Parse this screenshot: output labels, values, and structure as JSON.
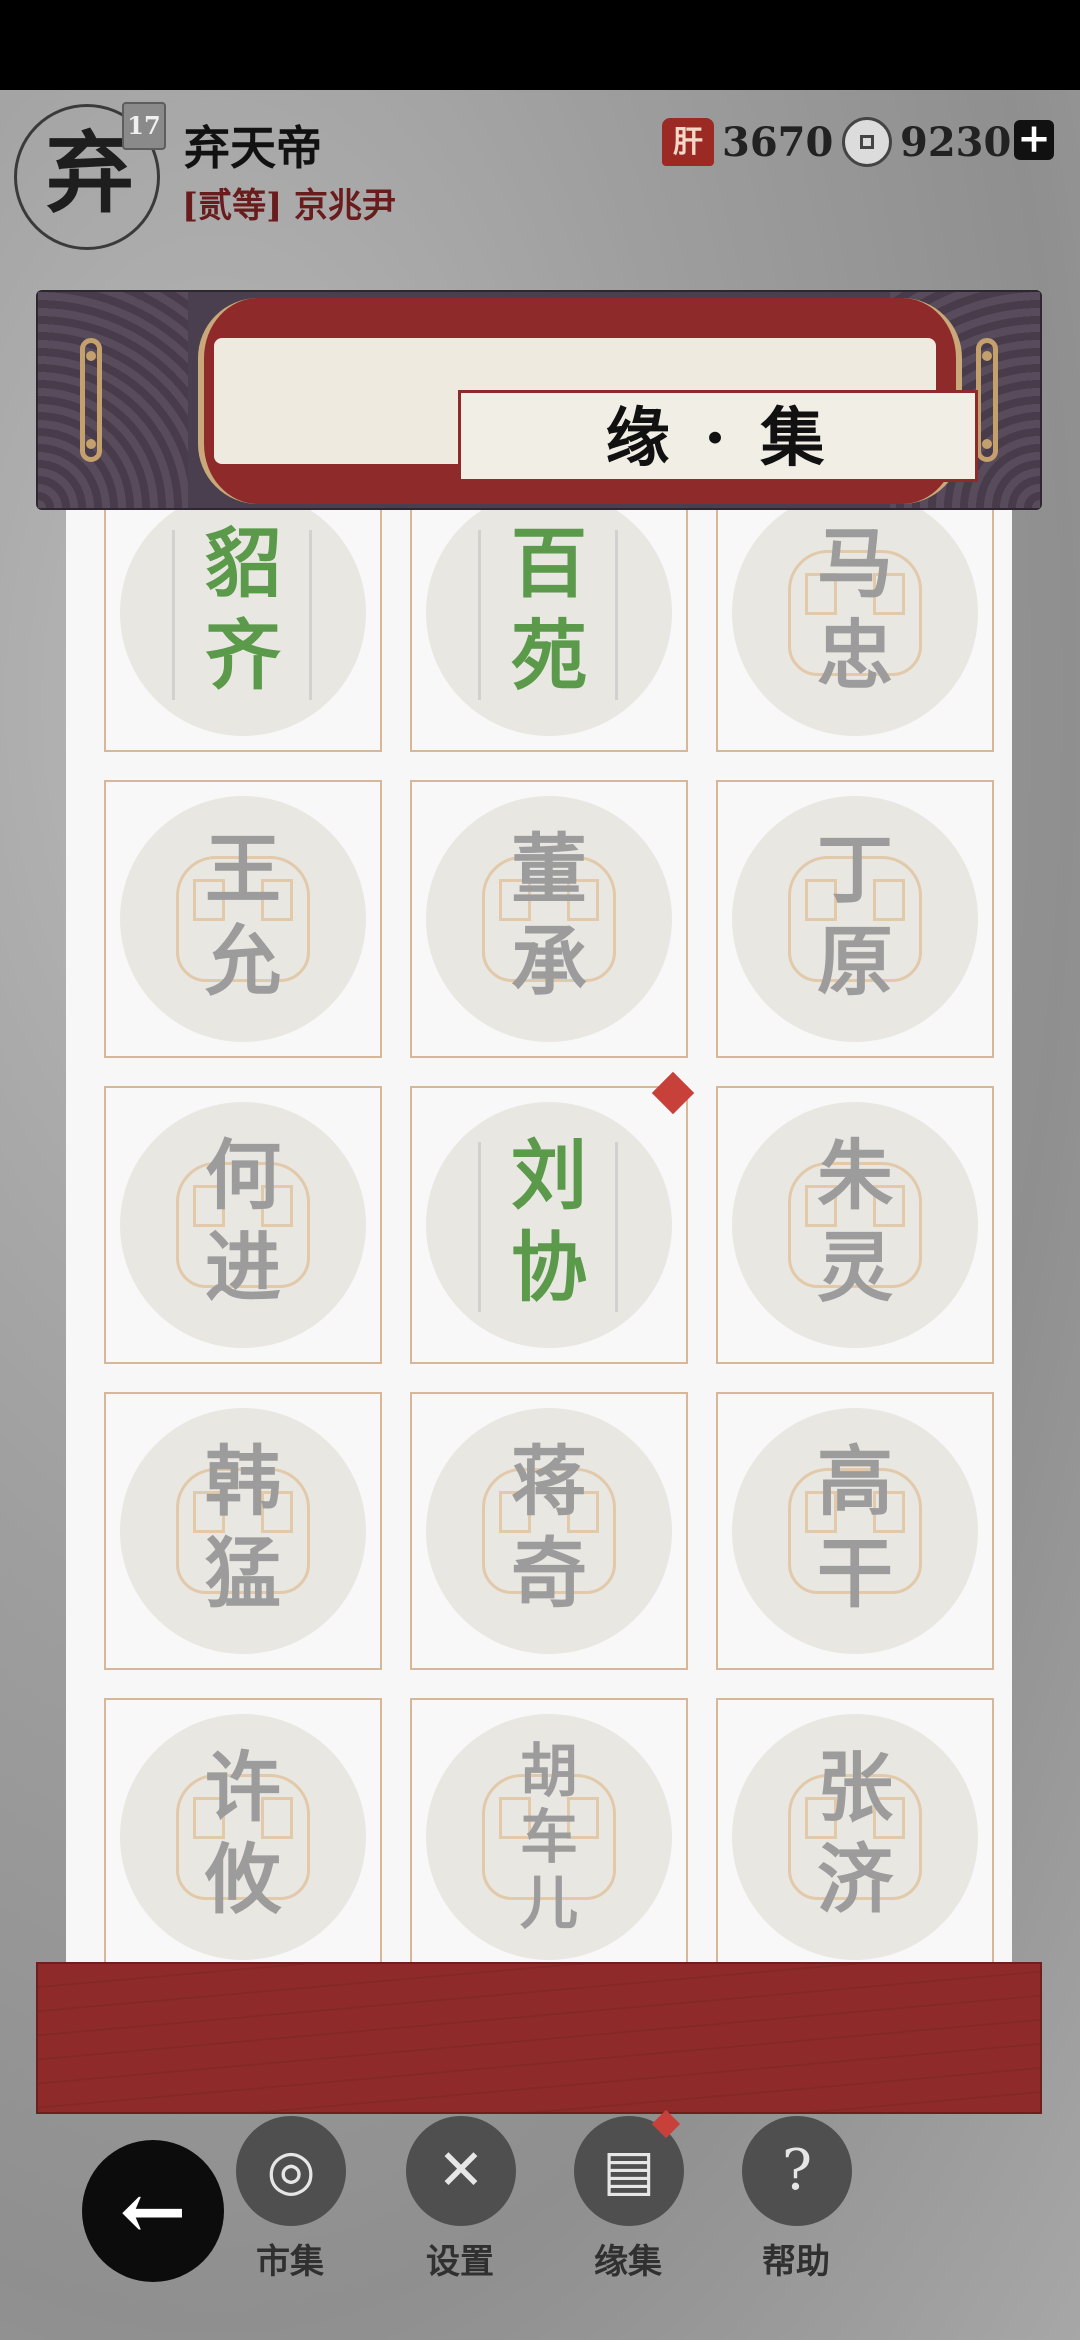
{
  "player": {
    "avatar_char": "弃",
    "level": "17",
    "name": "弃天帝",
    "rank": "[贰等] 京兆尹"
  },
  "resources": {
    "house_icon_char": "肝",
    "house_value": "3670",
    "coin_value": "9230",
    "plus_label": "+"
  },
  "title": "缘 · 集",
  "cards": [
    {
      "chars": [
        "貂",
        "齐"
      ],
      "unlocked": true
    },
    {
      "chars": [
        "百",
        "苑"
      ],
      "unlocked": true
    },
    {
      "chars": [
        "马",
        "忠"
      ],
      "unlocked": false
    },
    {
      "chars": [
        "王",
        "允"
      ],
      "unlocked": false
    },
    {
      "chars": [
        "董",
        "承"
      ],
      "unlocked": false
    },
    {
      "chars": [
        "丁",
        "原"
      ],
      "unlocked": false
    },
    {
      "chars": [
        "何",
        "进"
      ],
      "unlocked": false
    },
    {
      "chars": [
        "刘",
        "协"
      ],
      "unlocked": true,
      "new": true
    },
    {
      "chars": [
        "朱",
        "灵"
      ],
      "unlocked": false
    },
    {
      "chars": [
        "韩",
        "猛"
      ],
      "unlocked": false
    },
    {
      "chars": [
        "蒋",
        "奇"
      ],
      "unlocked": false
    },
    {
      "chars": [
        "高",
        "干"
      ],
      "unlocked": false
    },
    {
      "chars": [
        "许",
        "攸"
      ],
      "unlocked": false
    },
    {
      "chars": [
        "胡",
        "车",
        "儿"
      ],
      "unlocked": false
    },
    {
      "chars": [
        "张",
        "济"
      ],
      "unlocked": false
    }
  ],
  "nav": {
    "back_glyph": "←",
    "items": [
      {
        "label": "市集",
        "icon": "market-icon",
        "glyph": "◎"
      },
      {
        "label": "设置",
        "icon": "settings-icon",
        "glyph": "✕"
      },
      {
        "label": "缘集",
        "icon": "collection-icon",
        "glyph": "▤",
        "new": true
      },
      {
        "label": "帮助",
        "icon": "help-icon",
        "glyph": "?"
      }
    ]
  },
  "colors": {
    "accent_red": "#8e2b2a",
    "unlocked_green": "#5a9a4a",
    "locked_gray": "#9c9c9c"
  }
}
